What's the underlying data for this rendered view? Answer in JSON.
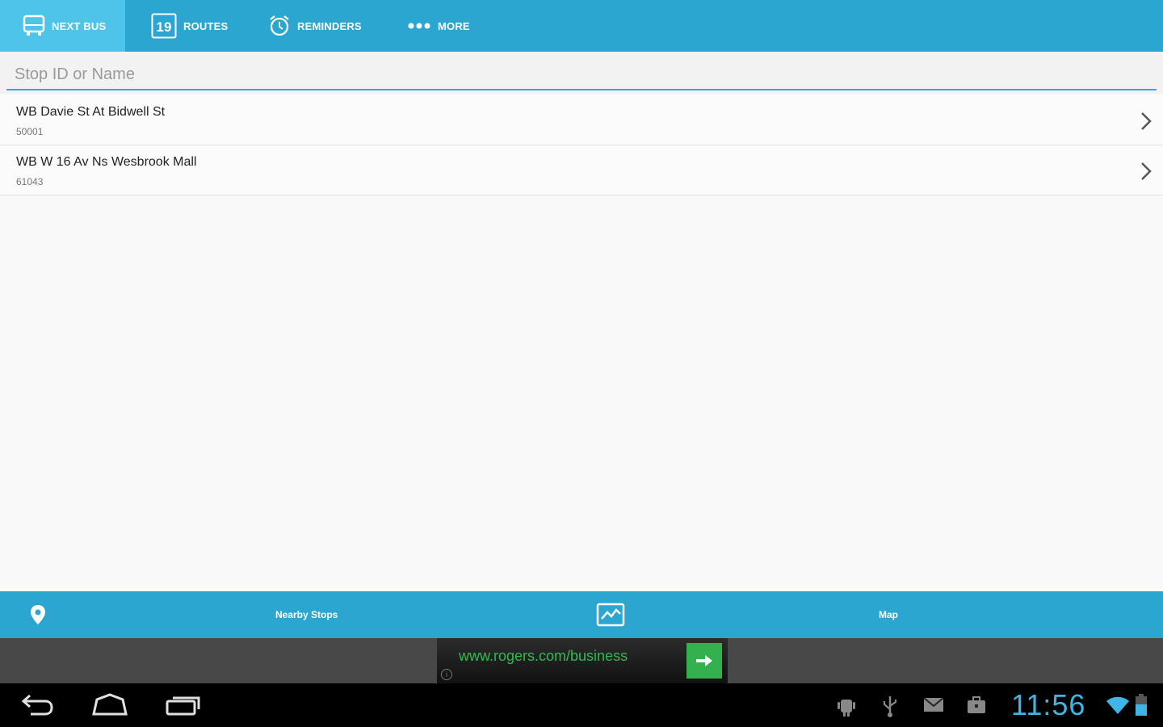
{
  "tabs": [
    {
      "label": "NEXT BUS",
      "icon": "bus-icon",
      "active": true
    },
    {
      "label": "ROUTES",
      "icon": "route-number-icon",
      "badge": "19",
      "active": false
    },
    {
      "label": "REMINDERS",
      "icon": "alarm-clock-icon",
      "active": false
    },
    {
      "label": "MORE",
      "icon": "more-dots-icon",
      "active": false
    }
  ],
  "search": {
    "placeholder": "Stop ID or Name",
    "value": ""
  },
  "stops": [
    {
      "name": "WB Davie St At Bidwell St",
      "id": "50001"
    },
    {
      "name": "WB W 16 Av Ns Wesbrook Mall",
      "id": "61043"
    }
  ],
  "actions": {
    "nearby_label": "Nearby Stops",
    "map_label": "Map"
  },
  "ad": {
    "url_text": "www.rogers.com/business",
    "info_glyph": "i"
  },
  "system": {
    "clock": "11:56"
  },
  "colors": {
    "primary": "#2ba6d0",
    "active_tab": "#4fc4ea",
    "accent_line": "#33a9d6",
    "ad_text": "#2bbd4e",
    "clock": "#3fb5e5"
  }
}
